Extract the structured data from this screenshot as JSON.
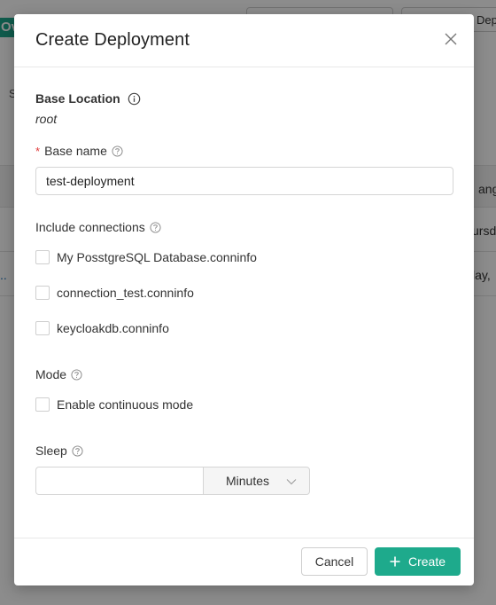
{
  "background": {
    "badge_text": "Ov",
    "top_button_2": "Dep",
    "small_text": "S",
    "table_header_partial": "ange",
    "row1_right": "ursd",
    "row2_left": "..",
    "row2_right": "lay,"
  },
  "modal": {
    "title": "Create Deployment",
    "base_location": {
      "label": "Base Location",
      "value": "root"
    },
    "base_name": {
      "required_mark": "*",
      "label": "Base name",
      "value": "test-deployment"
    },
    "connections": {
      "label": "Include connections",
      "items": [
        {
          "label": "My PosstgreSQL Database.conninfo",
          "checked": false
        },
        {
          "label": "connection_test.conninfo",
          "checked": false
        },
        {
          "label": "keycloakdb.conninfo",
          "checked": false
        }
      ]
    },
    "mode": {
      "label": "Mode",
      "option_label": "Enable continuous mode",
      "checked": false
    },
    "sleep": {
      "label": "Sleep",
      "value": "",
      "unit": "Minutes"
    },
    "footer": {
      "cancel_label": "Cancel",
      "create_label": "Create"
    }
  },
  "colors": {
    "primary": "#1eaa8c",
    "required": "#e03a3a",
    "overlay": "rgba(0,0,0,0.45)"
  },
  "icons": {
    "close": "close-icon",
    "help": "question-circle-icon",
    "info": "info-circle-icon",
    "chevron": "chevron-down-icon",
    "plus": "plus-icon"
  }
}
